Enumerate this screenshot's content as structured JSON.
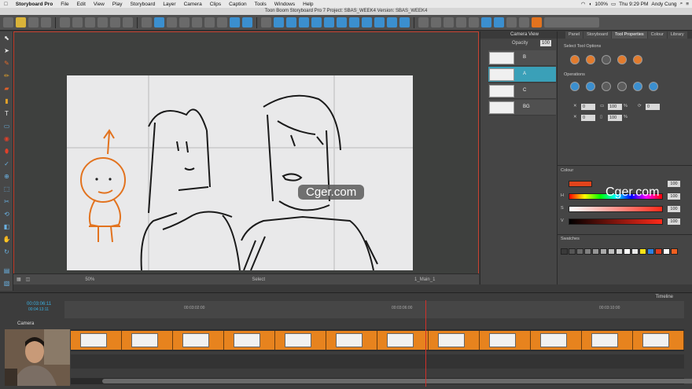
{
  "menubar": {
    "app_name": "Storyboard Pro",
    "items": [
      "File",
      "Edit",
      "View",
      "Play",
      "Storyboard",
      "Layer",
      "Camera",
      "Clips",
      "Caption",
      "Tools",
      "Windows",
      "Help"
    ],
    "battery": "100%",
    "clock": "Thu 9:29 PM",
    "user": "Andy Cung"
  },
  "window_title": "Toon Boom Storyboard Pro 7 Project: SBAS_WEEK4 Version: SBAS_WEEK4",
  "camera_view": {
    "title": "Camera View",
    "opacity_label": "Opacity",
    "opacity_value": "100",
    "layers": [
      {
        "name": "B",
        "selected": false
      },
      {
        "name": "A",
        "selected": true
      },
      {
        "name": "C",
        "selected": false
      },
      {
        "name": "BG",
        "selected": false
      }
    ]
  },
  "right_panel": {
    "tabs": [
      "Panel",
      "Storyboard",
      "Tool Properties",
      "Colour",
      "Library"
    ],
    "active_tab": "Tool Properties",
    "select_tool_options": "Select Tool Options",
    "operations": "Operations",
    "fields": {
      "x_val": "0",
      "y_val": "0",
      "w_val": "100",
      "h_val": "100",
      "angle_val": "0",
      "w_unit": "%",
      "h_unit": "%"
    },
    "colour_section": "Colour",
    "colour_values": [
      "100",
      "100",
      "100",
      "100"
    ],
    "colour_row_labels": [
      "H",
      "S",
      "V"
    ],
    "swatches_section": "Swatches",
    "swatches_colors": [
      "#3a3a3a",
      "#555",
      "#6a6a6a",
      "#808080",
      "#959595",
      "#aaaaaa",
      "#bfbfbf",
      "#d4d4d4",
      "#ffffff",
      "#e8e8e8",
      "#f7e218",
      "#2b7fe0",
      "#e23b1c",
      "#ffffff",
      "#f06020"
    ]
  },
  "stage_bar": {
    "zoom": "50%",
    "layer_label": "Select",
    "panel_info": "1_Main_1"
  },
  "timeline": {
    "title": "Timeline",
    "timecode_main": "00:03:06:11",
    "timecode_sub": "00:04:13:11",
    "ruler_marks": [
      "00:03:02:00",
      "00:03:06:00",
      "00:03:10:00"
    ],
    "track_name": "Camera",
    "panel_count": 12
  },
  "watermark": "Cger.com",
  "colors": {
    "accent_orange": "#e7831e",
    "selection_cyan": "#3aa0b8",
    "frame_red": "#c8402e"
  }
}
